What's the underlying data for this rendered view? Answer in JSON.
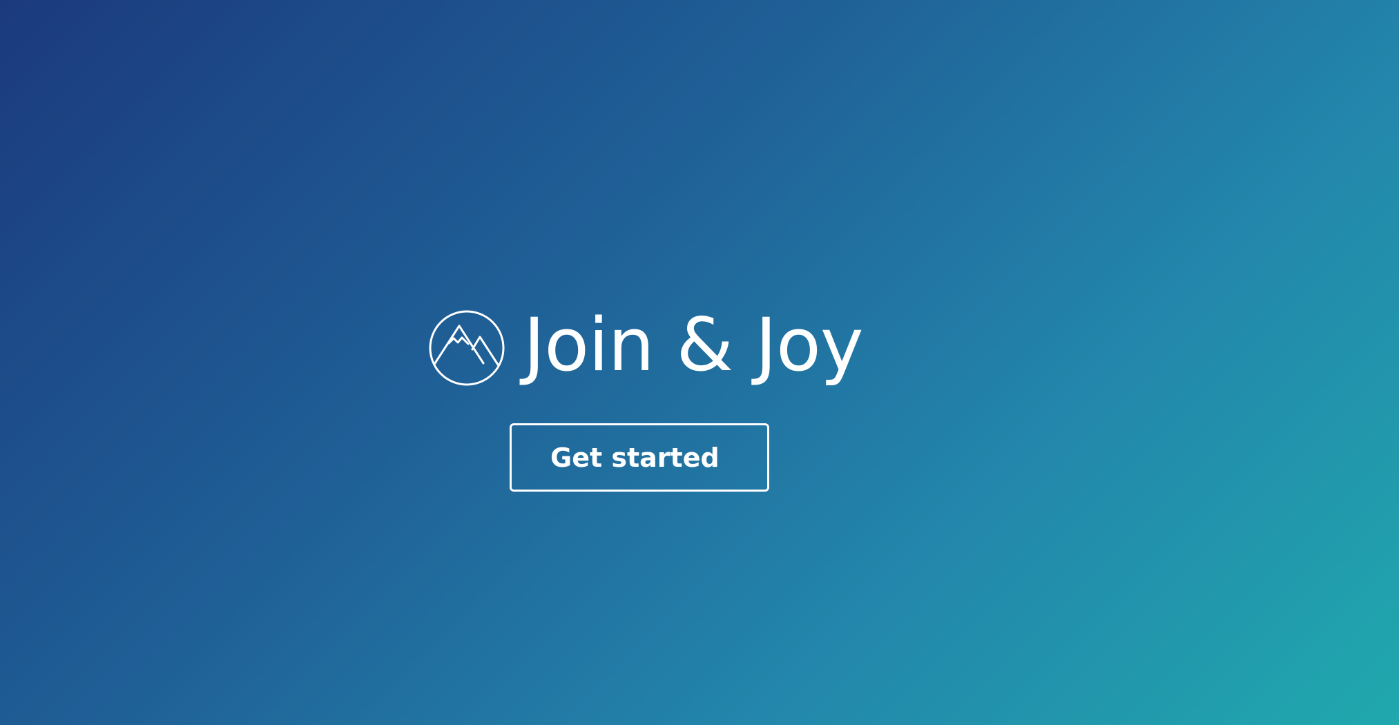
{
  "brand": {
    "name": "Join & Joy",
    "logo_icon": "mountain-circle-icon"
  },
  "cta": {
    "label": "Get started"
  },
  "colors": {
    "gradient_start": "#1b3a7d",
    "gradient_mid": "#1f5f96",
    "gradient_end": "#20a8ad",
    "foreground": "#ffffff"
  }
}
